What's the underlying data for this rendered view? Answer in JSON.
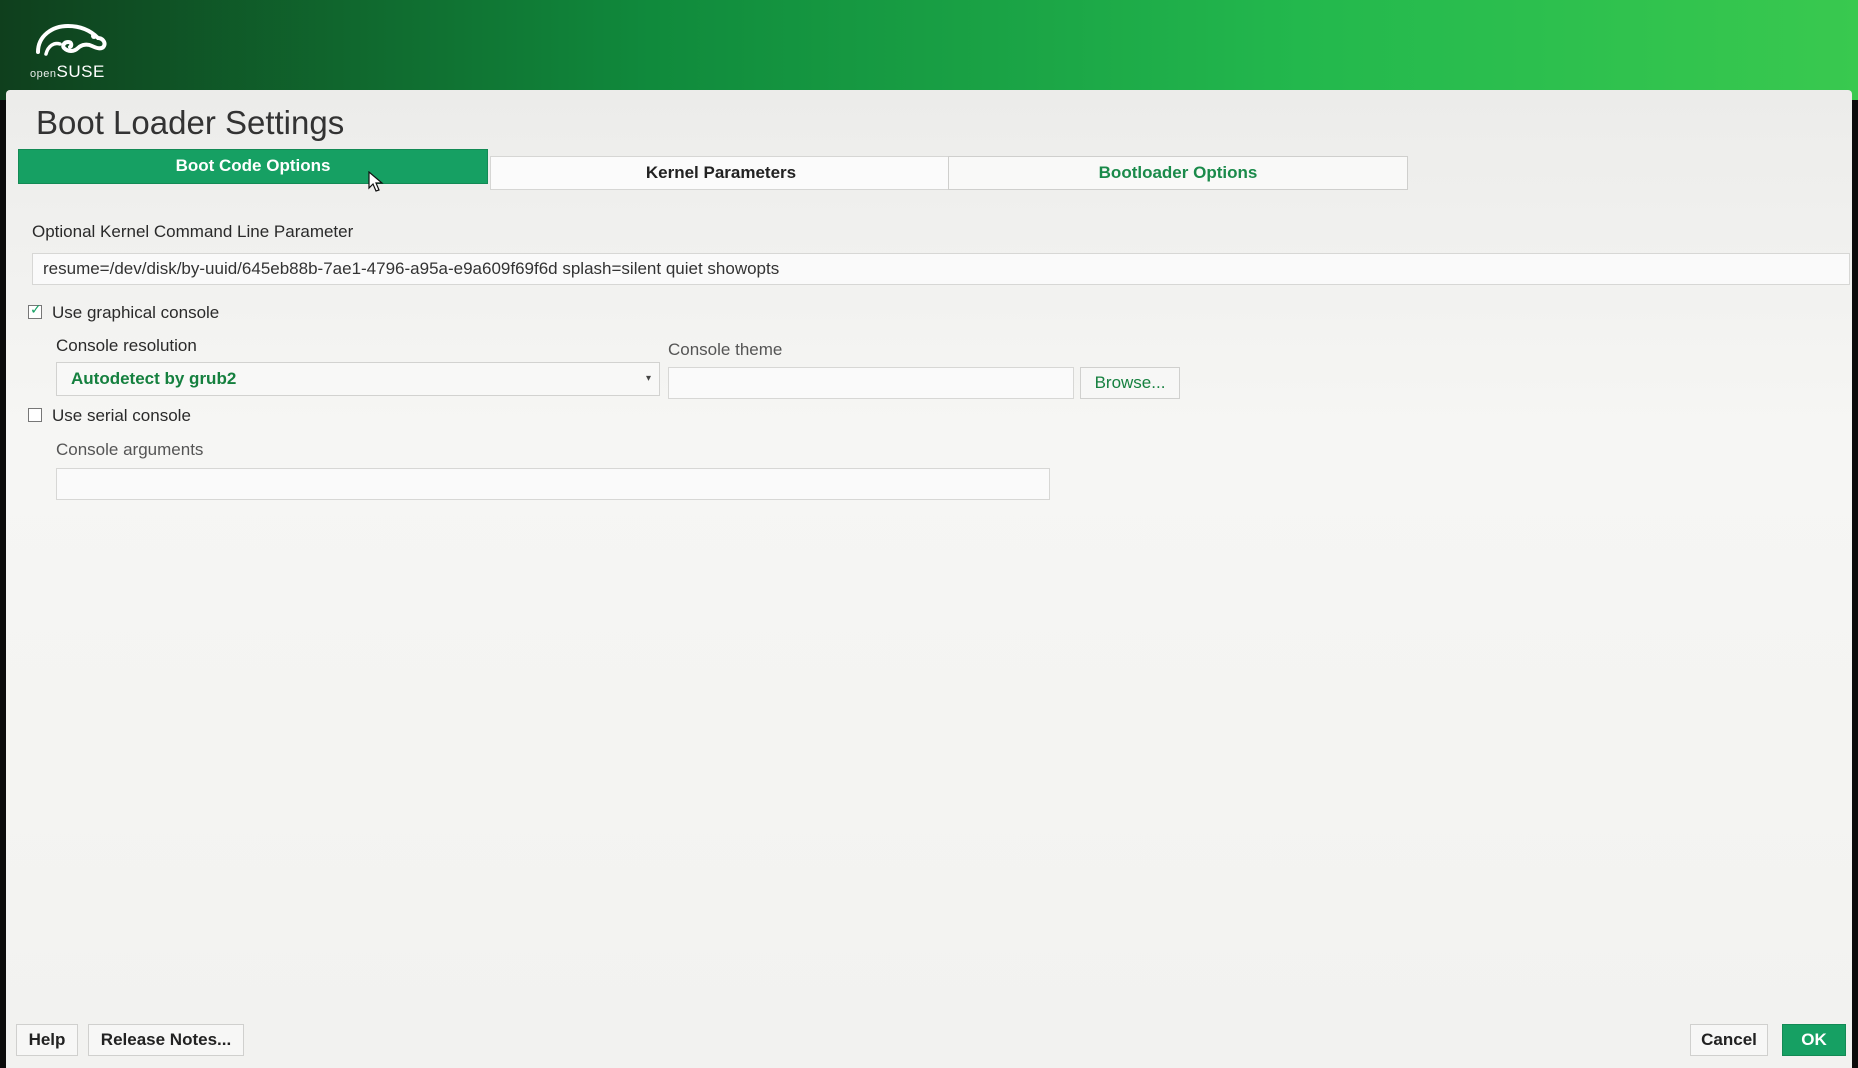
{
  "brand": {
    "logo_prefix": "open",
    "logo_name": "SUSE",
    "colors": {
      "accent": "#16a063",
      "header_dark": "#0f3f1d",
      "header_light": "#39c94f"
    }
  },
  "page": {
    "title": "Boot Loader Settings"
  },
  "tabs": [
    {
      "label": "Boot Code Options",
      "active": true
    },
    {
      "label": "Kernel Parameters",
      "active": false
    },
    {
      "label": "Bootloader Options",
      "active": false
    }
  ],
  "kernel": {
    "label": "Optional Kernel Command Line Parameter",
    "value": "resume=/dev/disk/by-uuid/645eb88b-7ae1-4796-a95a-e9a609f69f6d splash=silent quiet showopts"
  },
  "graphical_console": {
    "label": "Use graphical console",
    "checked": true,
    "resolution_label": "Console resolution",
    "resolution_value": "Autodetect by grub2",
    "theme_label": "Console theme",
    "theme_value": "",
    "browse_label": "Browse..."
  },
  "serial_console": {
    "label": "Use serial console",
    "checked": false,
    "arguments_label": "Console arguments",
    "arguments_value": ""
  },
  "footer": {
    "help": "Help",
    "release_notes": "Release Notes...",
    "cancel": "Cancel",
    "ok": "OK"
  }
}
